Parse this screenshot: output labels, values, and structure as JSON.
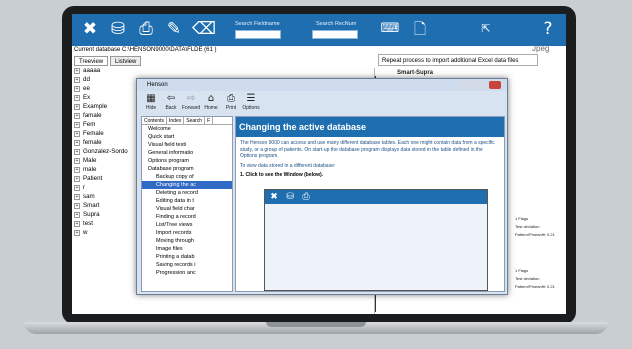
{
  "toolbar": {
    "search_fieldname_label": "Search Fieldname",
    "search_recnum_label": "Search RecNum",
    "right_label": "Jpeg"
  },
  "current_database": "Current database C:\\HENSON9000\\DATA\\FLDE (61 )",
  "repeat_process": "Repeat process to import additional Excel data files",
  "tabs": [
    "Treeview",
    "Listview"
  ],
  "tree": [
    "aaaaa",
    "dd",
    "ee",
    "Ex",
    "Example",
    "famale",
    "Fem",
    "Female",
    "female",
    "Gonzalez-Sordo",
    "Male",
    "male",
    "Patient",
    "r",
    "sam",
    "Smart",
    "Supra",
    "test",
    "w"
  ],
  "help": {
    "title": "Henson",
    "tools": [
      "Hide",
      "Back",
      "Forward",
      "Home",
      "Print",
      "Options"
    ],
    "tabs": [
      "Contents",
      "Index",
      "Search",
      "F"
    ],
    "nodes": [
      "Welcome",
      "Quick start",
      "Visual field testi",
      "General informatio",
      "Options program",
      "Database program",
      "Backup copy of",
      "Changing the ac",
      "Deleting a record",
      "Editing data in t",
      "Visual field char",
      "Finding a record",
      "List/Tree views",
      "Import records",
      "Moving through",
      "Image files",
      "Printing a datab",
      "Saving records i",
      "Progression anc"
    ],
    "heading": "Changing the active database",
    "para1": "The Henson 9000 can access and use many different database tables. Each one might contain data from a specific study, or a group of patients. On start-up the database program displays data stored in the table defined in the Options program.",
    "para2": "To view data stored in a different database:",
    "step": "1.   Click      to see the Window (below)."
  },
  "report": {
    "title": "Smart-Supra",
    "lines": [
      "1 Flags",
      "Test deviation",
      "Pattern/Pmeanfit: 0.21",
      "1 Flags",
      "Test deviation",
      "Pattern/Pmeanfit: 0.21"
    ]
  }
}
